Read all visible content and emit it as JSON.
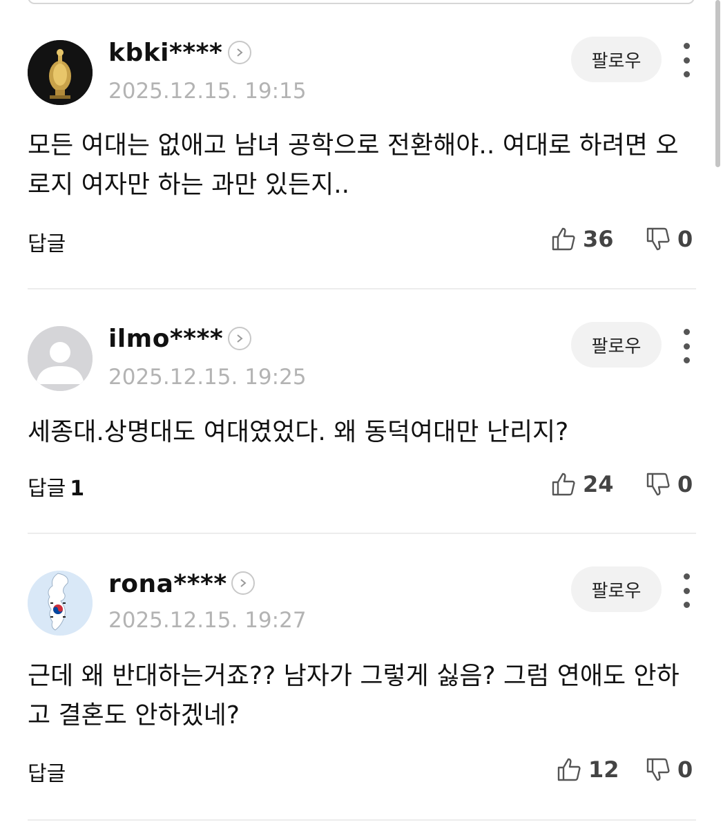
{
  "comments": [
    {
      "username": "kbki****",
      "timestamp": "2025.12.15. 19:15",
      "follow_label": "팔로우",
      "text": "모든 여대는 없애고 남녀 공학으로 전환해야.. 여대로 하려면 오로지 여자만 하는 과만 있든지..",
      "reply_label": "답글",
      "reply_count": "",
      "likes": "36",
      "dislikes": "0",
      "avatar": "golden-crown-photo"
    },
    {
      "username": "ilmo****",
      "timestamp": "2025.12.15. 19:25",
      "follow_label": "팔로우",
      "text": "세종대.상명대도 여대였었다. 왜 동덕여대만 난리지?",
      "reply_label": "답글",
      "reply_count": "1",
      "likes": "24",
      "dislikes": "0",
      "avatar": "default-person-silhouette"
    },
    {
      "username": "rona****",
      "timestamp": "2025.12.15. 19:27",
      "follow_label": "팔로우",
      "text": "근데 왜 반대하는거죠?? 남자가 그렇게 싫음? 그럼 연애도 안하고 결혼도 안하겠네?",
      "reply_label": "답글",
      "reply_count": "",
      "likes": "12",
      "dislikes": "0",
      "avatar": "korea-map-flag"
    }
  ],
  "colors": {
    "timestamp": "#b3b3b3",
    "follow_bg": "#f2f2f2",
    "divider": "#ececec"
  }
}
